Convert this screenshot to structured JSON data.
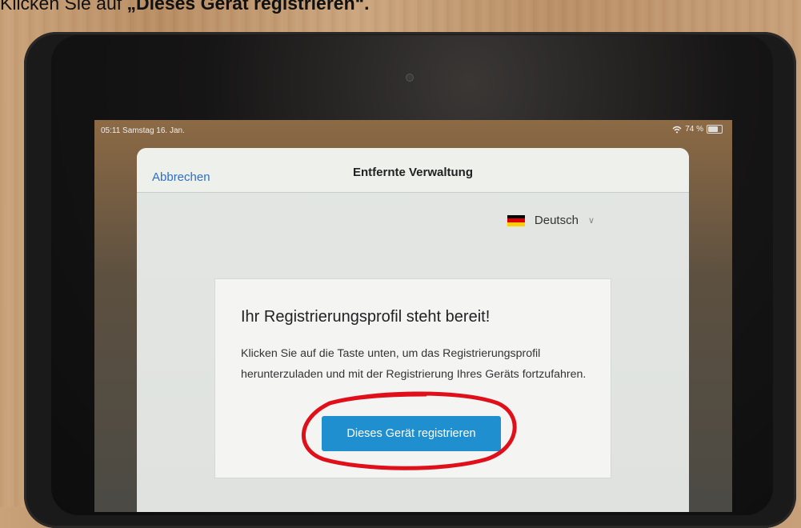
{
  "caption": {
    "prefix": "Klicken Sie auf ",
    "highlight": "„Dieses Gerät registrieren“."
  },
  "status_bar": {
    "time_date": "05:11  Samstag 16. Jan.",
    "battery_label": "74 %",
    "battery_level": 0.74
  },
  "sheet": {
    "cancel_label": "Abbrechen",
    "title": "Entfernte Verwaltung"
  },
  "language": {
    "label": "Deutsch",
    "flag_colors": [
      "#000000",
      "#dd0000",
      "#ffce00"
    ]
  },
  "card": {
    "title": "Ihr Registrierungsprofil steht bereit!",
    "body": "Klicken Sie auf die Taste unten, um das Registrierungsprofil herunterzuladen und mit der Registrierung Ihres Geräts fortzufahren.",
    "button_label": "Dieses Gerät registrieren"
  },
  "colors": {
    "accent_link": "#2d6fc4",
    "primary_button": "#1f8fd0",
    "annotation_circle": "#e0101a"
  }
}
